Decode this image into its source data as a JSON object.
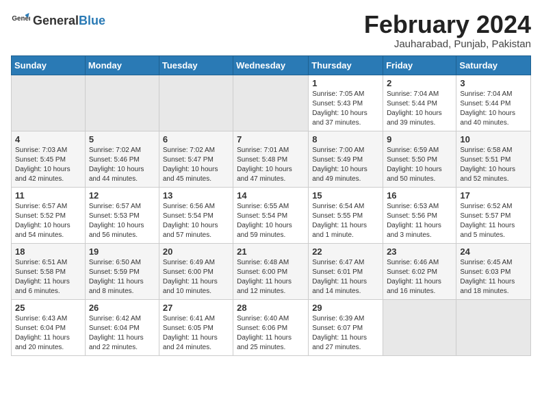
{
  "header": {
    "logo_general": "General",
    "logo_blue": "Blue",
    "month_title": "February 2024",
    "location": "Jauharabad, Punjab, Pakistan"
  },
  "weekdays": [
    "Sunday",
    "Monday",
    "Tuesday",
    "Wednesday",
    "Thursday",
    "Friday",
    "Saturday"
  ],
  "weeks": [
    [
      {
        "day": "",
        "info": ""
      },
      {
        "day": "",
        "info": ""
      },
      {
        "day": "",
        "info": ""
      },
      {
        "day": "",
        "info": ""
      },
      {
        "day": "1",
        "info": "Sunrise: 7:05 AM\nSunset: 5:43 PM\nDaylight: 10 hours\nand 37 minutes."
      },
      {
        "day": "2",
        "info": "Sunrise: 7:04 AM\nSunset: 5:44 PM\nDaylight: 10 hours\nand 39 minutes."
      },
      {
        "day": "3",
        "info": "Sunrise: 7:04 AM\nSunset: 5:44 PM\nDaylight: 10 hours\nand 40 minutes."
      }
    ],
    [
      {
        "day": "4",
        "info": "Sunrise: 7:03 AM\nSunset: 5:45 PM\nDaylight: 10 hours\nand 42 minutes."
      },
      {
        "day": "5",
        "info": "Sunrise: 7:02 AM\nSunset: 5:46 PM\nDaylight: 10 hours\nand 44 minutes."
      },
      {
        "day": "6",
        "info": "Sunrise: 7:02 AM\nSunset: 5:47 PM\nDaylight: 10 hours\nand 45 minutes."
      },
      {
        "day": "7",
        "info": "Sunrise: 7:01 AM\nSunset: 5:48 PM\nDaylight: 10 hours\nand 47 minutes."
      },
      {
        "day": "8",
        "info": "Sunrise: 7:00 AM\nSunset: 5:49 PM\nDaylight: 10 hours\nand 49 minutes."
      },
      {
        "day": "9",
        "info": "Sunrise: 6:59 AM\nSunset: 5:50 PM\nDaylight: 10 hours\nand 50 minutes."
      },
      {
        "day": "10",
        "info": "Sunrise: 6:58 AM\nSunset: 5:51 PM\nDaylight: 10 hours\nand 52 minutes."
      }
    ],
    [
      {
        "day": "11",
        "info": "Sunrise: 6:57 AM\nSunset: 5:52 PM\nDaylight: 10 hours\nand 54 minutes."
      },
      {
        "day": "12",
        "info": "Sunrise: 6:57 AM\nSunset: 5:53 PM\nDaylight: 10 hours\nand 56 minutes."
      },
      {
        "day": "13",
        "info": "Sunrise: 6:56 AM\nSunset: 5:54 PM\nDaylight: 10 hours\nand 57 minutes."
      },
      {
        "day": "14",
        "info": "Sunrise: 6:55 AM\nSunset: 5:54 PM\nDaylight: 10 hours\nand 59 minutes."
      },
      {
        "day": "15",
        "info": "Sunrise: 6:54 AM\nSunset: 5:55 PM\nDaylight: 11 hours\nand 1 minute."
      },
      {
        "day": "16",
        "info": "Sunrise: 6:53 AM\nSunset: 5:56 PM\nDaylight: 11 hours\nand 3 minutes."
      },
      {
        "day": "17",
        "info": "Sunrise: 6:52 AM\nSunset: 5:57 PM\nDaylight: 11 hours\nand 5 minutes."
      }
    ],
    [
      {
        "day": "18",
        "info": "Sunrise: 6:51 AM\nSunset: 5:58 PM\nDaylight: 11 hours\nand 6 minutes."
      },
      {
        "day": "19",
        "info": "Sunrise: 6:50 AM\nSunset: 5:59 PM\nDaylight: 11 hours\nand 8 minutes."
      },
      {
        "day": "20",
        "info": "Sunrise: 6:49 AM\nSunset: 6:00 PM\nDaylight: 11 hours\nand 10 minutes."
      },
      {
        "day": "21",
        "info": "Sunrise: 6:48 AM\nSunset: 6:00 PM\nDaylight: 11 hours\nand 12 minutes."
      },
      {
        "day": "22",
        "info": "Sunrise: 6:47 AM\nSunset: 6:01 PM\nDaylight: 11 hours\nand 14 minutes."
      },
      {
        "day": "23",
        "info": "Sunrise: 6:46 AM\nSunset: 6:02 PM\nDaylight: 11 hours\nand 16 minutes."
      },
      {
        "day": "24",
        "info": "Sunrise: 6:45 AM\nSunset: 6:03 PM\nDaylight: 11 hours\nand 18 minutes."
      }
    ],
    [
      {
        "day": "25",
        "info": "Sunrise: 6:43 AM\nSunset: 6:04 PM\nDaylight: 11 hours\nand 20 minutes."
      },
      {
        "day": "26",
        "info": "Sunrise: 6:42 AM\nSunset: 6:04 PM\nDaylight: 11 hours\nand 22 minutes."
      },
      {
        "day": "27",
        "info": "Sunrise: 6:41 AM\nSunset: 6:05 PM\nDaylight: 11 hours\nand 24 minutes."
      },
      {
        "day": "28",
        "info": "Sunrise: 6:40 AM\nSunset: 6:06 PM\nDaylight: 11 hours\nand 25 minutes."
      },
      {
        "day": "29",
        "info": "Sunrise: 6:39 AM\nSunset: 6:07 PM\nDaylight: 11 hours\nand 27 minutes."
      },
      {
        "day": "",
        "info": ""
      },
      {
        "day": "",
        "info": ""
      }
    ]
  ]
}
